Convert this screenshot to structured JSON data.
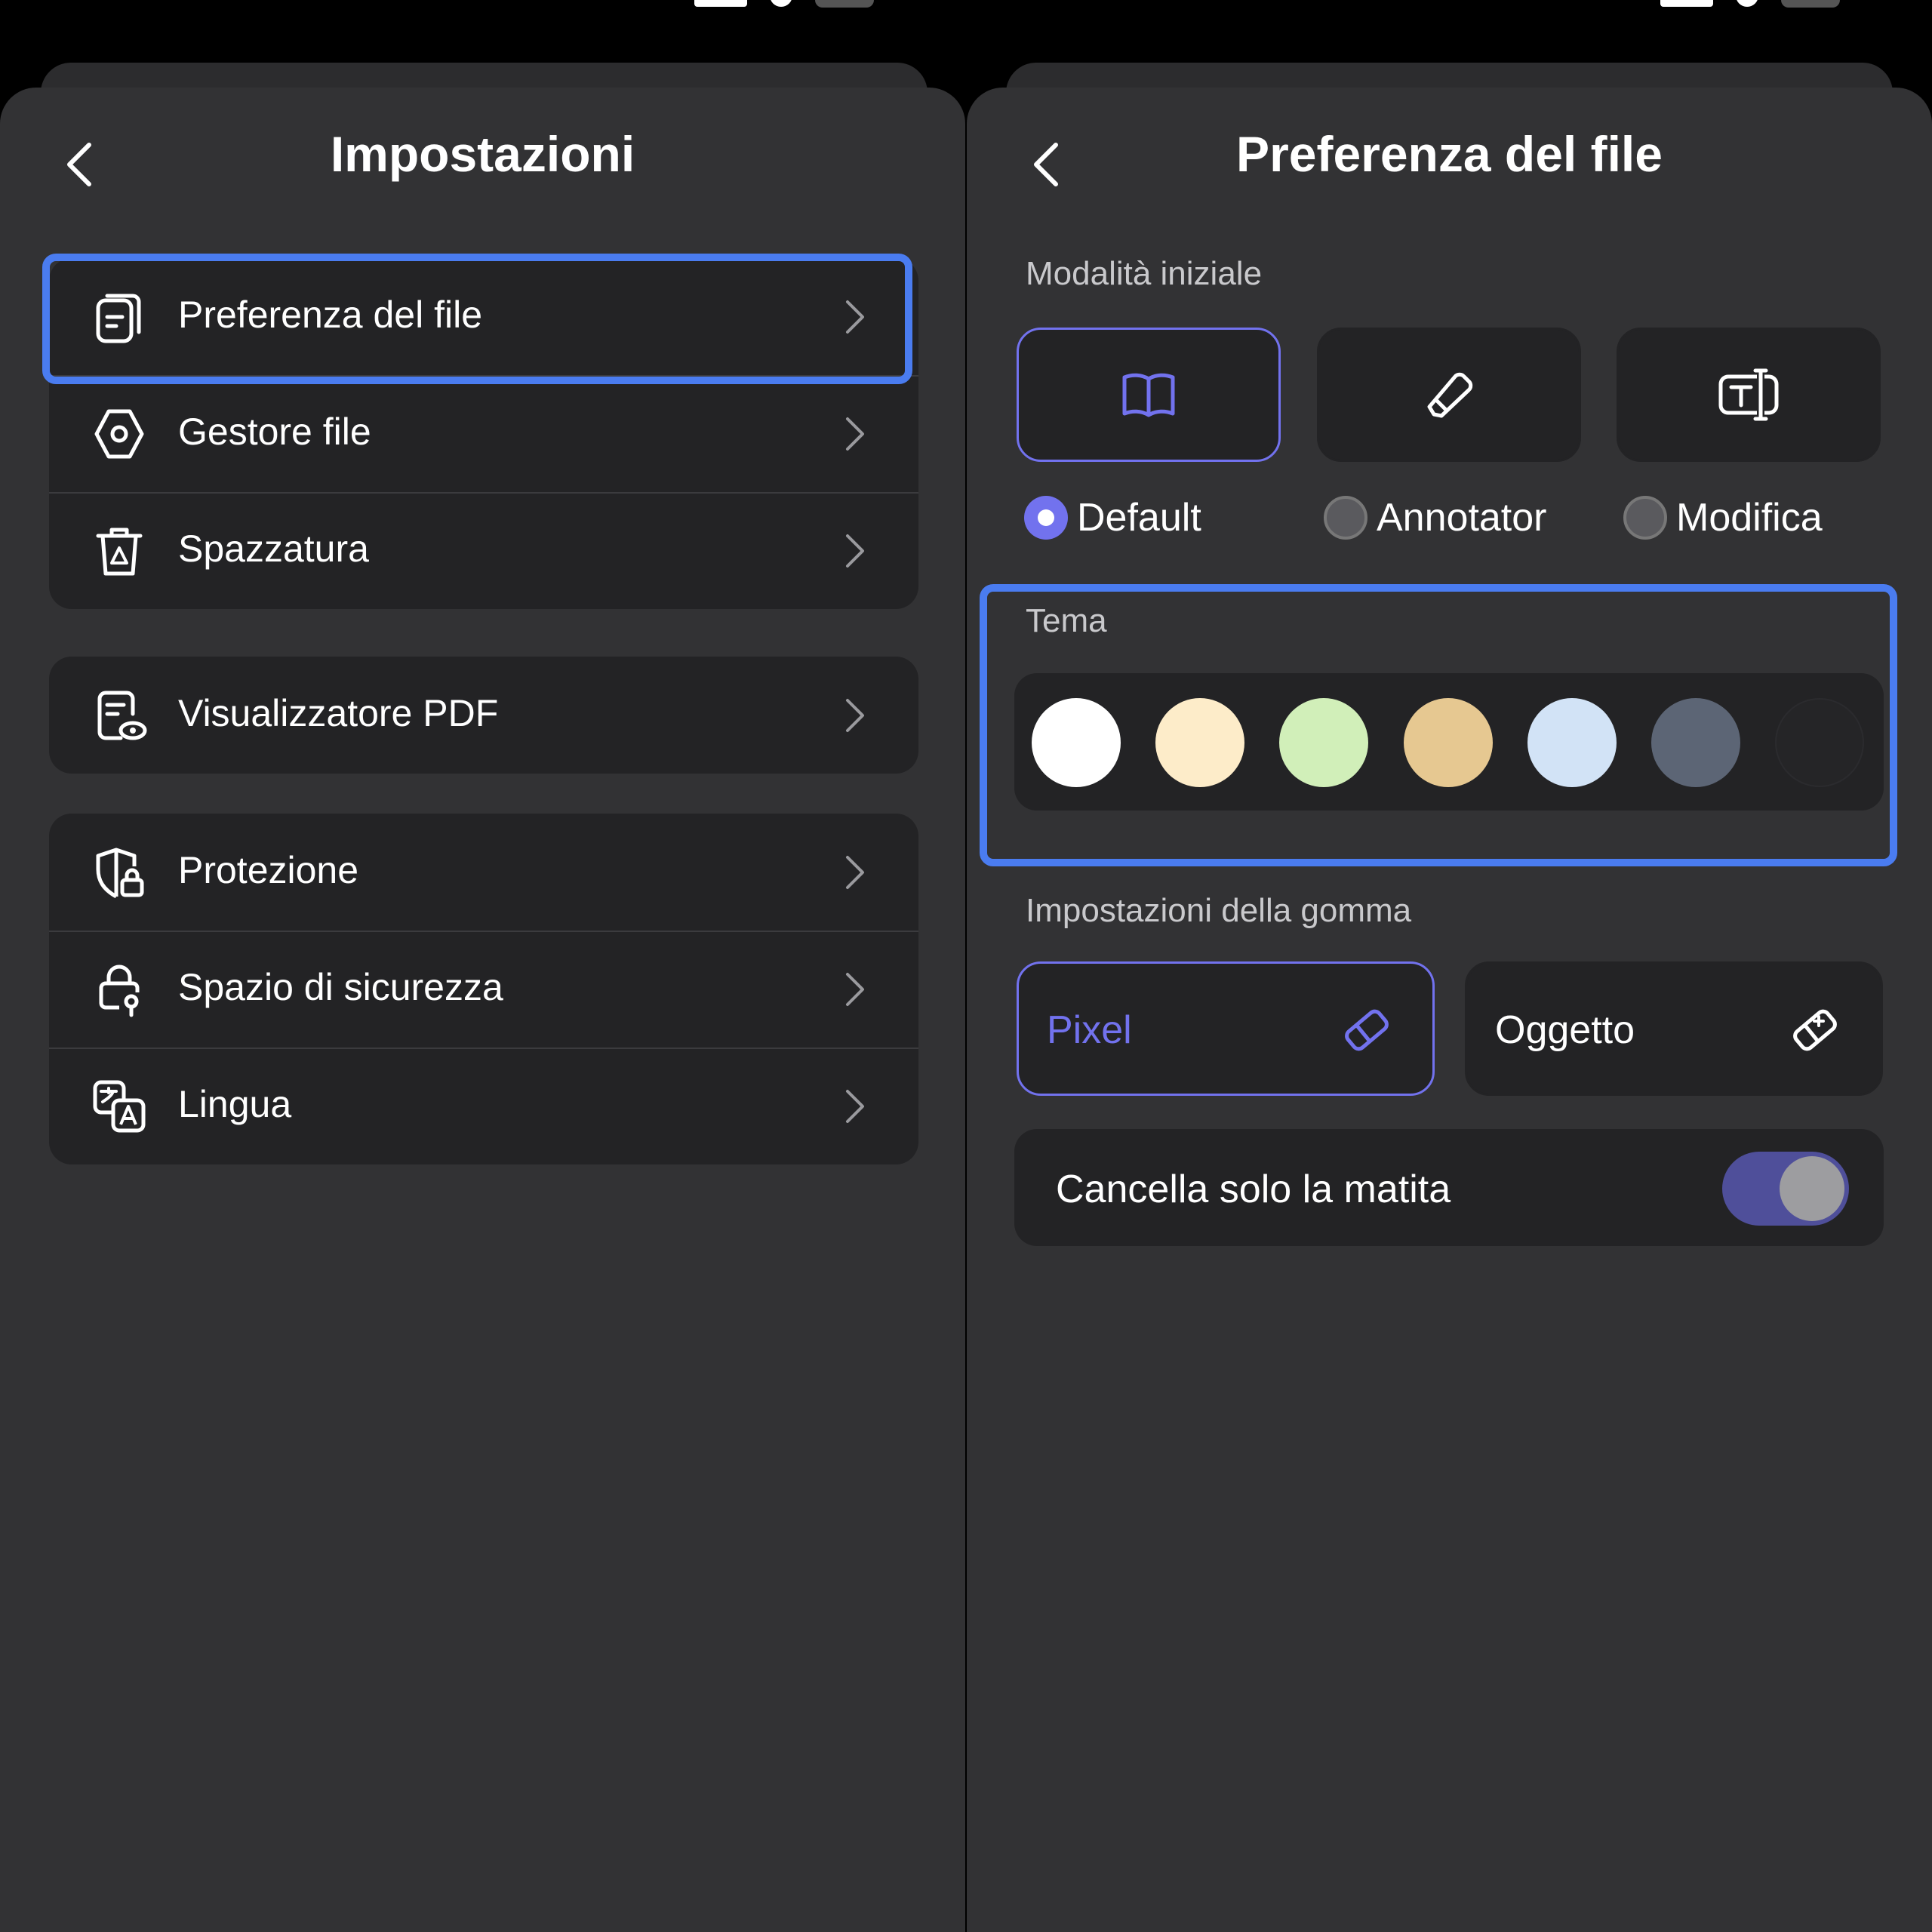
{
  "colors": {
    "accent": "#7272ee",
    "highlight": "#4a7cf0",
    "panel": "#323234",
    "card": "#232325"
  },
  "left": {
    "title": "Impostazioni",
    "groups": [
      [
        {
          "label": "Preferenza del file",
          "icon": "file-preference-icon"
        },
        {
          "label": "Gestore file",
          "icon": "file-manager-icon"
        },
        {
          "label": "Spazzatura",
          "icon": "trash-icon"
        }
      ],
      [
        {
          "label": "Visualizzatore PDF",
          "icon": "pdf-viewer-icon"
        }
      ],
      [
        {
          "label": "Protezione",
          "icon": "shield-lock-icon"
        },
        {
          "label": "Spazio di sicurezza",
          "icon": "secure-lock-icon"
        },
        {
          "label": "Lingua",
          "icon": "language-icon"
        }
      ]
    ]
  },
  "right": {
    "title": "Preferenza del file",
    "initial_mode_label": "Modalità iniziale",
    "modes": [
      {
        "label": "Default",
        "icon": "book-icon",
        "selected": true
      },
      {
        "label": "Annotator",
        "icon": "pen-icon",
        "selected": false
      },
      {
        "label": "Modifica",
        "icon": "text-edit-icon",
        "selected": false
      }
    ],
    "theme_label": "Tema",
    "theme_colors": [
      "#ffffff",
      "#fdecc9",
      "#d1efb9",
      "#e6c891",
      "#d2e3f6",
      "#5c6575",
      "#252527"
    ],
    "eraser_label": "Impostazioni della gomma",
    "eraser_options": [
      {
        "label": "Pixel",
        "icon": "eraser-icon",
        "selected": true
      },
      {
        "label": "Oggetto",
        "icon": "object-eraser-icon",
        "selected": false
      }
    ],
    "pencil_only": {
      "label": "Cancella solo la matita",
      "on": true
    }
  }
}
